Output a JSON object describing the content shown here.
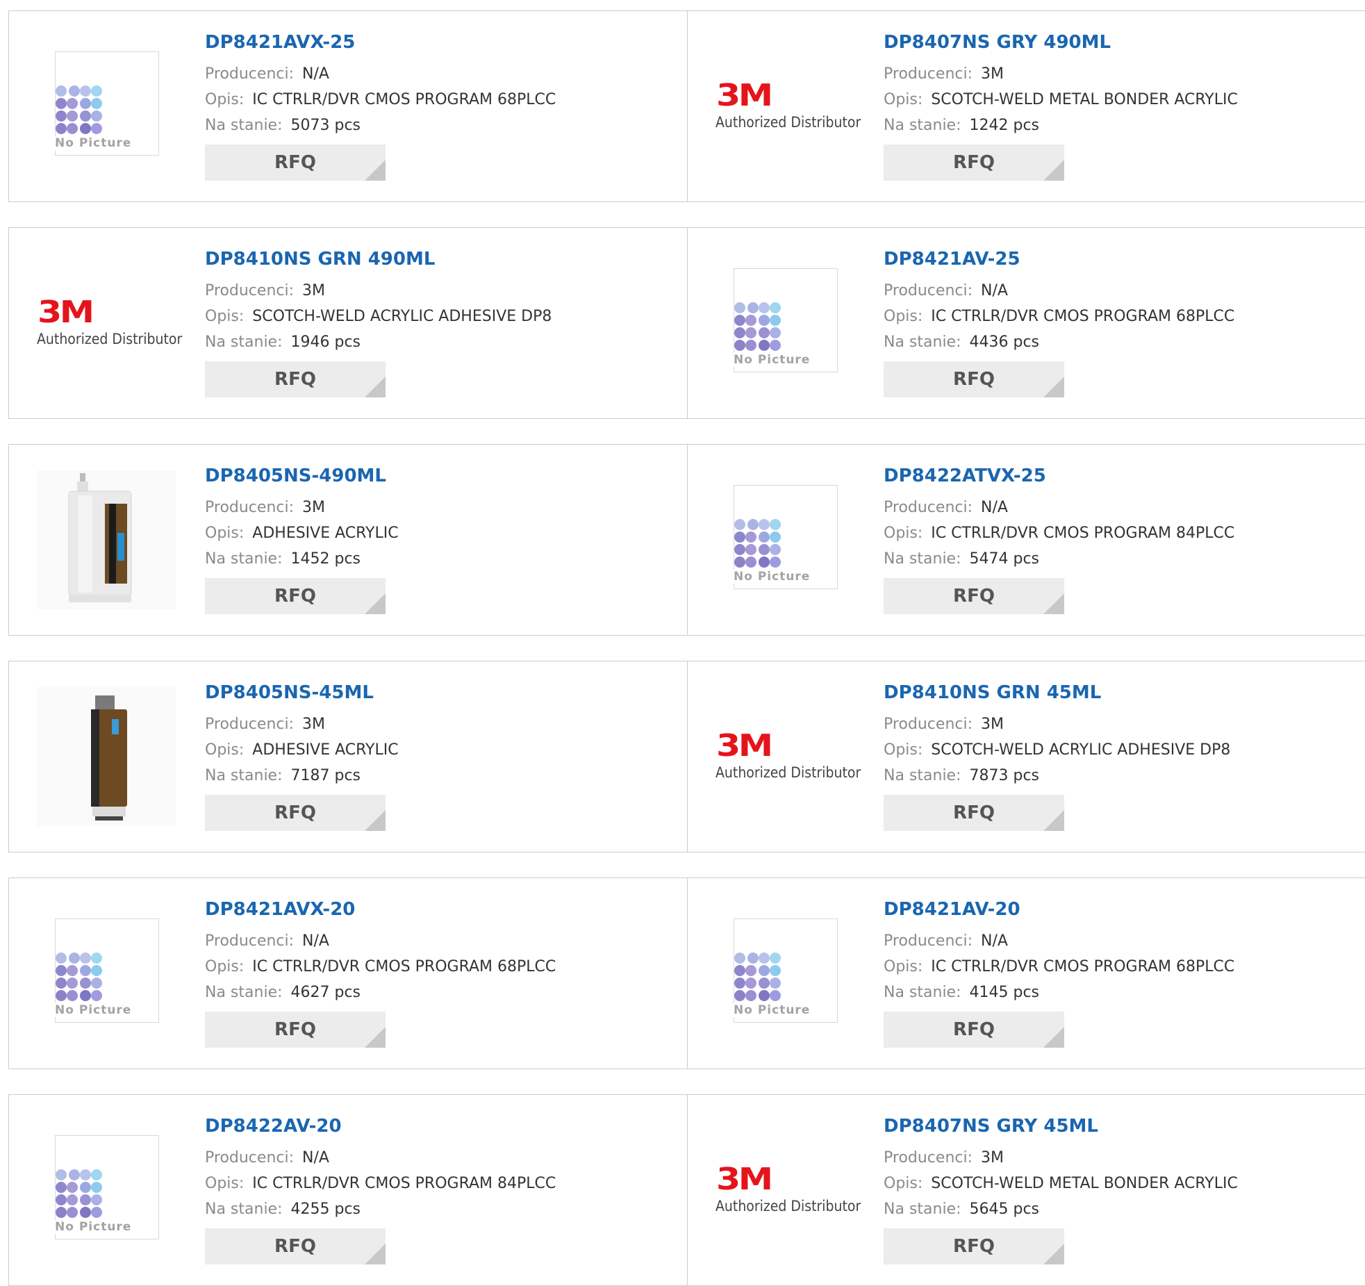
{
  "labels": {
    "manufacturer": "Producenci:",
    "description": "Opis:",
    "stock": "Na stanie:",
    "rfq": "RFQ"
  },
  "no_picture_text": "No Picture",
  "logo": {
    "brand": "3M",
    "caption": "Authorized Distributor"
  },
  "colors": {
    "link": "#1a66b0",
    "brand_red": "#e5141b",
    "button_bg": "#ececec",
    "border": "#cccccc"
  },
  "products": [
    {
      "part": "DP8421AVX-25",
      "manufacturer": "N/A",
      "description": "IC CTRLR/DVR CMOS PROGRAM 68PLCC",
      "stock": "5073 pcs",
      "image": "no-picture"
    },
    {
      "part": "DP8407NS GRY 490ML",
      "manufacturer": "3M",
      "description": "SCOTCH-WELD METAL BONDER ACRYLIC",
      "stock": "1242 pcs",
      "image": "3m-logo"
    },
    {
      "part": "DP8410NS GRN 490ML",
      "manufacturer": "3M",
      "description": "SCOTCH-WELD ACRYLIC ADHESIVE DP8",
      "stock": "1946 pcs",
      "image": "3m-logo"
    },
    {
      "part": "DP8421AV-25",
      "manufacturer": "N/A",
      "description": "IC CTRLR/DVR CMOS PROGRAM 68PLCC",
      "stock": "4436 pcs",
      "image": "no-picture"
    },
    {
      "part": "DP8405NS-490ML",
      "manufacturer": "3M",
      "description": "ADHESIVE ACRYLIC",
      "stock": "1452 pcs",
      "image": "product-large"
    },
    {
      "part": "DP8422ATVX-25",
      "manufacturer": "N/A",
      "description": "IC CTRLR/DVR CMOS PROGRAM 84PLCC",
      "stock": "5474 pcs",
      "image": "no-picture"
    },
    {
      "part": "DP8405NS-45ML",
      "manufacturer": "3M",
      "description": "ADHESIVE ACRYLIC",
      "stock": "7187 pcs",
      "image": "product-small"
    },
    {
      "part": "DP8410NS GRN 45ML",
      "manufacturer": "3M",
      "description": "SCOTCH-WELD ACRYLIC ADHESIVE DP8",
      "stock": "7873 pcs",
      "image": "3m-logo"
    },
    {
      "part": "DP8421AVX-20",
      "manufacturer": "N/A",
      "description": "IC CTRLR/DVR CMOS PROGRAM 68PLCC",
      "stock": "4627 pcs",
      "image": "no-picture"
    },
    {
      "part": "DP8421AV-20",
      "manufacturer": "N/A",
      "description": "IC CTRLR/DVR CMOS PROGRAM 68PLCC",
      "stock": "4145 pcs",
      "image": "no-picture"
    },
    {
      "part": "DP8422AV-20",
      "manufacturer": "N/A",
      "description": "IC CTRLR/DVR CMOS PROGRAM 84PLCC",
      "stock": "4255 pcs",
      "image": "no-picture"
    },
    {
      "part": "DP8407NS GRY 45ML",
      "manufacturer": "3M",
      "description": "SCOTCH-WELD METAL BONDER ACRYLIC",
      "stock": "5645 pcs",
      "image": "3m-logo"
    }
  ]
}
